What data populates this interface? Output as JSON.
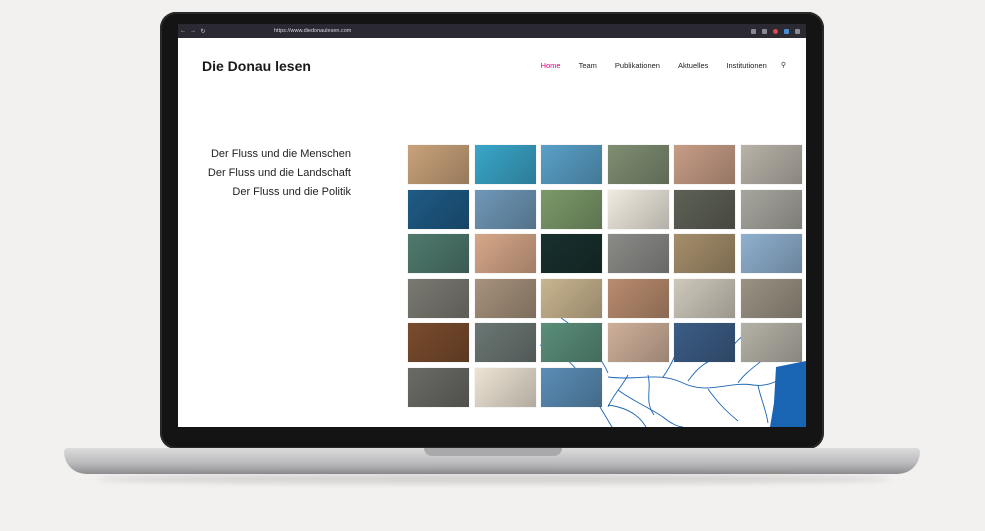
{
  "browser": {
    "url": "https://www.diedonaulesen.com",
    "back_icon": "back-arrow-icon",
    "forward_icon": "forward-arrow-icon",
    "reload_icon": "reload-icon"
  },
  "site": {
    "title": "Die Donau lesen",
    "nav": [
      {
        "label": "Home",
        "active": true
      },
      {
        "label": "Team",
        "active": false
      },
      {
        "label": "Publikationen",
        "active": false
      },
      {
        "label": "Aktuelles",
        "active": false
      },
      {
        "label": "Institutionen",
        "active": false
      }
    ],
    "accent_color": "#e6007e"
  },
  "themes": [
    "Der Fluss und die Menschen",
    "Der Fluss und die Landschaft",
    "Der Fluss und die Politik"
  ],
  "grid": {
    "tile_colors": [
      [
        "#c9a27a",
        "#3aa6c9",
        "#5aa0c8",
        "#7f8e72",
        "#c79d86",
        "#b8b2a8"
      ],
      [
        "#1e5b86",
        "#6f98b8",
        "#7c9a6a",
        "#f0ebe0",
        "#5e6156",
        "#a7a69e"
      ],
      [
        "#4f7a6e",
        "#d7a889",
        "#18302e",
        "#8b8b88",
        "#a58e6b",
        "#8fb0cf"
      ],
      [
        "#7b7a72",
        "#a7927c",
        "#c9b58f",
        "#b98c6e",
        "#cfc9bc",
        "#9a9283"
      ],
      [
        "#7a4c2d",
        "#6b7774",
        "#5a8f7a",
        "#cfb09a",
        "#3c5d86",
        "#b5b2a7"
      ],
      [
        "#6a6a66",
        "#ede4d4",
        "#5b8db6"
      ]
    ],
    "map_color": "#1a64b4"
  }
}
